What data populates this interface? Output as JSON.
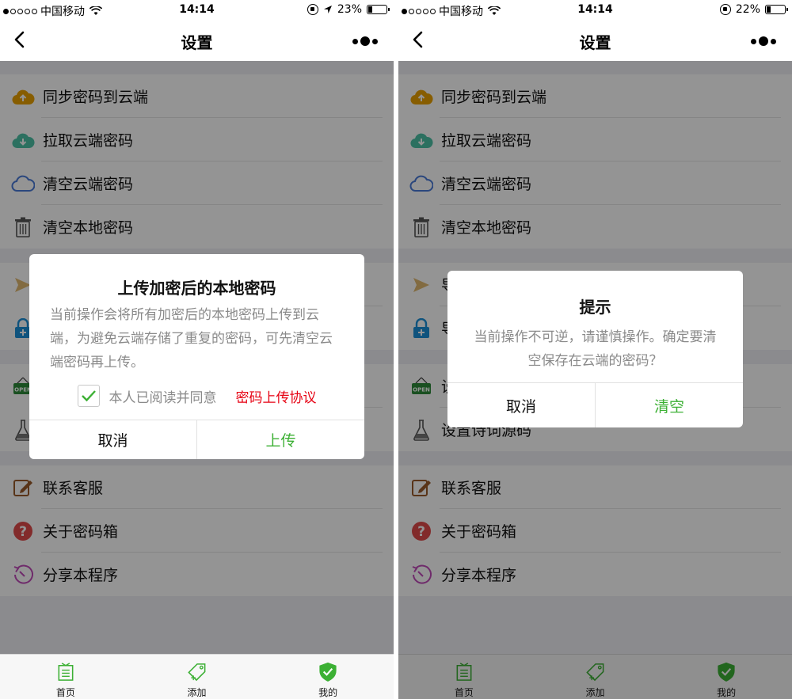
{
  "left": {
    "status": {
      "carrier": "中国移动",
      "time": "14:14",
      "battery": "23%",
      "battery_level": 0.23
    },
    "nav": {
      "title": "设置"
    },
    "groups": [
      {
        "rows": [
          {
            "label": "同步密码到云端",
            "icon": "cloud-upload-icon"
          },
          {
            "label": "拉取云端密码",
            "icon": "cloud-download-icon"
          },
          {
            "label": "清空云端密码",
            "icon": "cloud-outline-icon"
          },
          {
            "label": "清空本地密码",
            "icon": "trash-icon"
          }
        ]
      },
      {
        "rows": [
          {
            "label": "导",
            "icon": "paper-plane-icon"
          },
          {
            "label": "导",
            "icon": "lock-plus-icon"
          }
        ]
      },
      {
        "rows": [
          {
            "label": "设",
            "icon": "open-sign-icon"
          },
          {
            "label": "设置诗词源码",
            "icon": "flask-icon"
          }
        ]
      },
      {
        "rows": [
          {
            "label": "联系客服",
            "icon": "edit-icon"
          },
          {
            "label": "关于密码箱",
            "icon": "question-icon"
          },
          {
            "label": "分享本程序",
            "icon": "share-icon"
          }
        ]
      }
    ],
    "dialog": {
      "title": "上传加密后的本地密码",
      "body": "当前操作会将所有加密后的本地密码上传到云端，为避免云端存储了重复的密码，可先清空云端密码再上传。",
      "agree_text": "本人已阅读并同意",
      "agree_link": "密码上传协议",
      "cancel": "取消",
      "confirm": "上传"
    }
  },
  "right": {
    "status": {
      "carrier": "中国移动",
      "time": "14:14",
      "battery": "22%",
      "battery_level": 0.22
    },
    "nav": {
      "title": "设置"
    },
    "dialog": {
      "title": "提示",
      "body": "当前操作不可逆，请谨慎操作。确定要清空保存在云端的密码？",
      "cancel": "取消",
      "confirm": "清空"
    }
  },
  "tabs": [
    {
      "label": "首页",
      "icon": "home-doc-icon"
    },
    {
      "label": "添加",
      "icon": "tag-add-icon"
    },
    {
      "label": "我的",
      "icon": "shield-check-icon"
    }
  ],
  "colors": {
    "accent": "#3cb034",
    "danger": "#e60012",
    "orange": "#e8a000",
    "teal": "#4cc2a6",
    "blue": "#4a7ad8"
  }
}
